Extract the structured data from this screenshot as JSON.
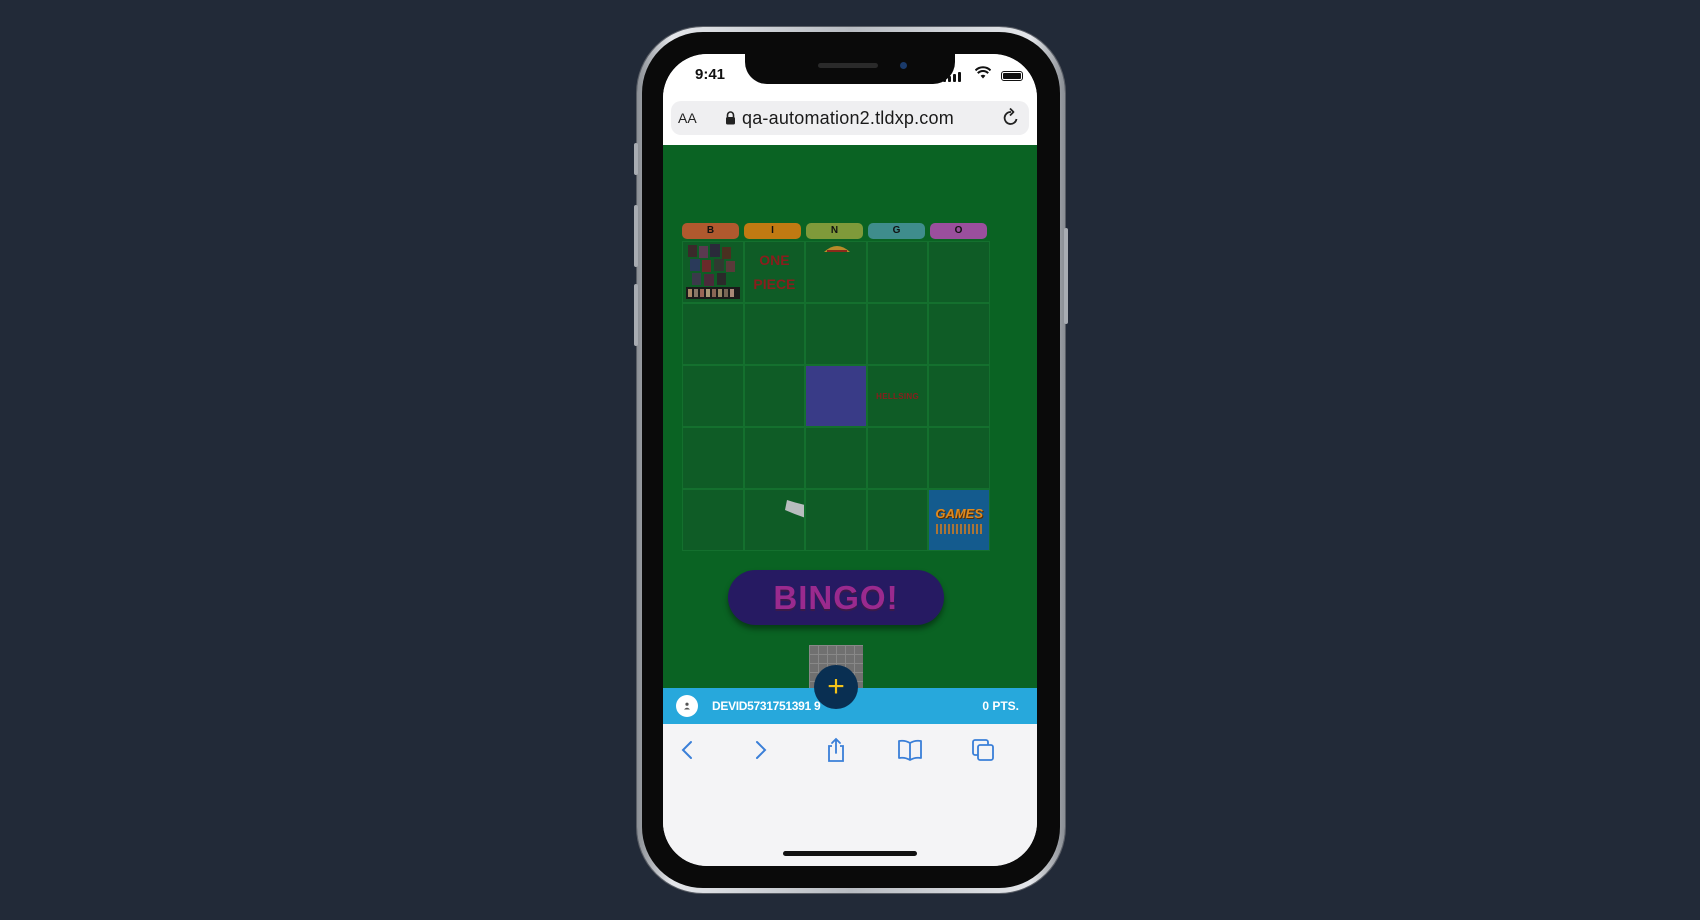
{
  "status_bar": {
    "time": "9:41"
  },
  "browser": {
    "text_size_label": "AA",
    "url": "qa-automation2.tldxp.com"
  },
  "game": {
    "column_headers": [
      {
        "letter": "B",
        "color": "#b0592e"
      },
      {
        "letter": "I",
        "color": "#c07a12"
      },
      {
        "letter": "N",
        "color": "#7f9a3a"
      },
      {
        "letter": "G",
        "color": "#3f8d8c"
      },
      {
        "letter": "O",
        "color": "#9a4f9d"
      }
    ],
    "cells": {
      "r1c2": "ONE PIECE",
      "r3c4": "HELLSING",
      "r5c5": "GAMES"
    },
    "bingo_label": "BINGO!",
    "add_label": "+"
  },
  "player": {
    "name": "DEVID5731751391 9",
    "points": "0 PTS."
  },
  "colors": {
    "background": "#222a38",
    "game_bg": "#0a6323",
    "player_bar": "#27a8dc",
    "bingo_button": "#261a62",
    "fab": "#092f52"
  }
}
